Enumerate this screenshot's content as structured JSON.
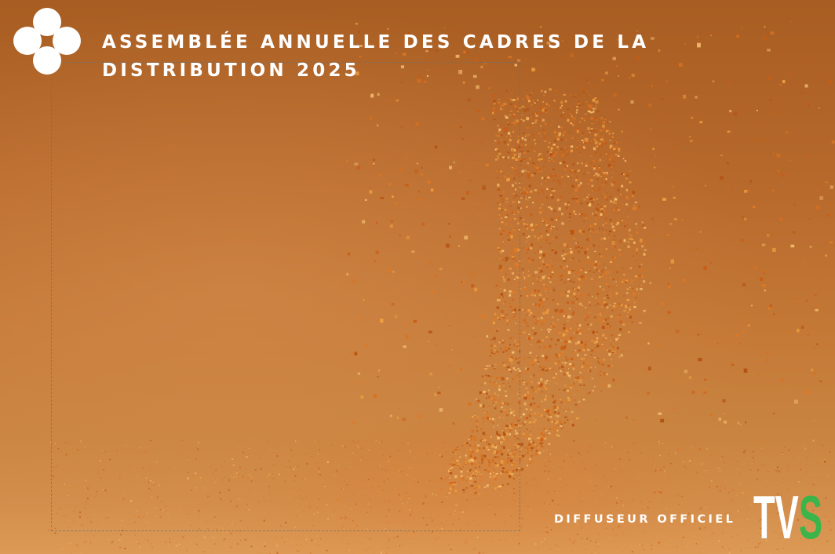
{
  "event": {
    "title": "ASSEMBLÉE ANNUELLE DES CADRES DE LA DISTRIBUTION 2025"
  },
  "broadcaster": {
    "label": "DIFFUSEUR OFFICIEL",
    "logo_text": "TVS",
    "logo_colors": {
      "tv": "#ffffff",
      "s": "#3bb54a"
    }
  },
  "theme": {
    "background": "#b8692a",
    "particles": "#e07a24",
    "text": "#ffffff"
  },
  "icons": {
    "brand_logo": "four-circle-cluster-icon"
  }
}
